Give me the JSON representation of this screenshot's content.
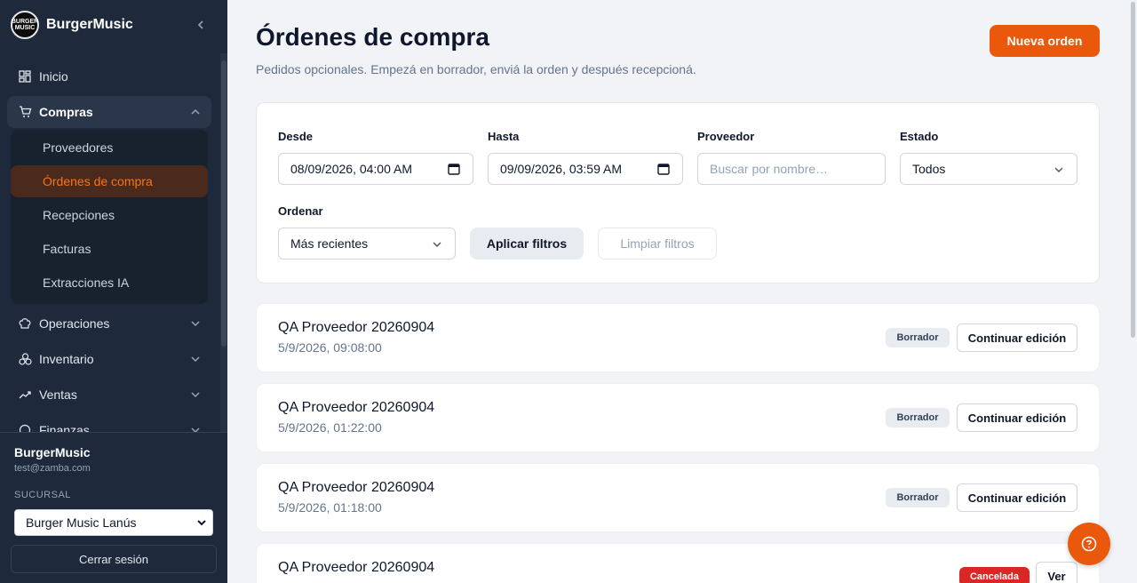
{
  "brand": {
    "name": "BurgerMusic",
    "logo_text": "BURGER MUSIC"
  },
  "nav": {
    "items": [
      {
        "label": "Inicio",
        "icon": "dashboard-icon"
      },
      {
        "label": "Compras",
        "icon": "cart-icon"
      },
      {
        "label": "Operaciones",
        "icon": "chef-hat-icon"
      },
      {
        "label": "Inventario",
        "icon": "boxes-icon"
      },
      {
        "label": "Ventas",
        "icon": "trend-up-icon"
      },
      {
        "label": "Finanzas",
        "icon": "finance-icon"
      }
    ],
    "submenu": [
      "Proveedores",
      "Órdenes de compra",
      "Recepciones",
      "Facturas",
      "Extracciones IA"
    ]
  },
  "user": {
    "name": "BurgerMusic",
    "email": "test@zamba.com"
  },
  "branch": {
    "label": "SUCURSAL",
    "value": "Burger Music Lanús"
  },
  "logout_label": "Cerrar sesión",
  "page": {
    "title": "Órdenes de compra",
    "subtitle": "Pedidos opcionales. Empezá en borrador, enviá la orden y después recepcioná.",
    "new_button": "Nueva orden"
  },
  "filters": {
    "from_label": "Desde",
    "from_value": "08/09/2026, 04:00 AM",
    "to_label": "Hasta",
    "to_value": "09/09/2026, 03:59 AM",
    "supplier_label": "Proveedor",
    "supplier_placeholder": "Buscar por nombre…",
    "status_label": "Estado",
    "status_value": "Todos",
    "sort_label": "Ordenar",
    "sort_value": "Más recientes",
    "apply": "Aplicar filtros",
    "clear": "Limpiar filtros"
  },
  "orders": [
    {
      "name": "QA Proveedor 20260904",
      "date": "5/9/2026, 09:08:00",
      "status": "Borrador",
      "action": "Continuar edición"
    },
    {
      "name": "QA Proveedor 20260904",
      "date": "5/9/2026, 01:22:00",
      "status": "Borrador",
      "action": "Continuar edición"
    },
    {
      "name": "QA Proveedor 20260904",
      "date": "5/9/2026, 01:18:00",
      "status": "Borrador",
      "action": "Continuar edición"
    },
    {
      "name": "QA Proveedor 20260904",
      "date": "",
      "status": "Cancelada",
      "action": "Ver"
    }
  ],
  "colors": {
    "accent": "#ea580c",
    "sidebar": "#1e293b",
    "danger": "#dc2626"
  }
}
